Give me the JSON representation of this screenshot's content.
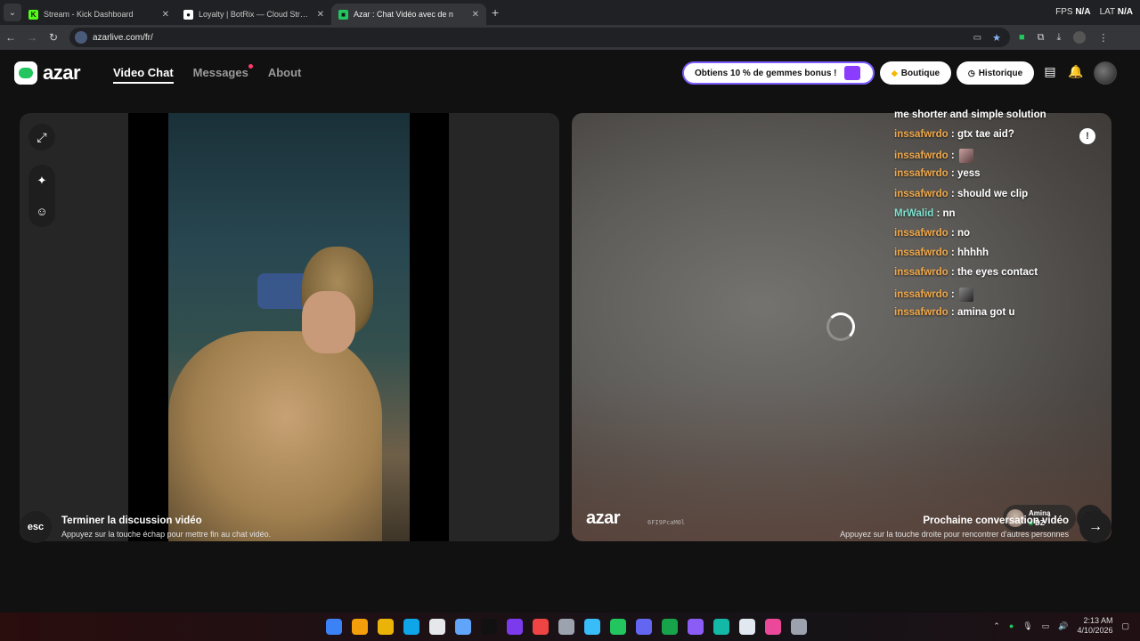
{
  "browser": {
    "tabs": [
      {
        "title": "Stream - Kick Dashboard",
        "favicon_color": "#53fc18",
        "favicon_glyph": "K",
        "active": false
      },
      {
        "title": "Loyalty | BotRix — Cloud Stream",
        "favicon_color": "#ffffff",
        "favicon_glyph": "●",
        "active": false
      },
      {
        "title": "Azar : Chat Vidéo avec de n",
        "favicon_color": "#22c55e",
        "favicon_glyph": "■",
        "active": true
      }
    ],
    "fps_label": "FPS",
    "fps_value": "N/A",
    "lat_label": "LAT",
    "lat_value": "N/A",
    "url": "azarlive.com/fr/"
  },
  "header": {
    "logo_text": "azar",
    "nav": [
      {
        "label": "Video Chat",
        "active": true
      },
      {
        "label": "Messages",
        "has_dot": true
      },
      {
        "label": "About"
      }
    ],
    "promo_label": "Obtiens 10 % de gemmes bonus !",
    "boutique_label": "Boutique",
    "historique_label": "Historique"
  },
  "remote": {
    "watermark": "azar",
    "match_id": "6FI9PcaM0l",
    "partner_name": "Amina",
    "partner_country": "DZ"
  },
  "chat": {
    "clipped_line": "me shorter and simple solution",
    "messages": [
      {
        "user": "inssafwrdo",
        "text": "gtx tae aid?"
      },
      {
        "user": "inssafwrdo",
        "text": "",
        "emote": true
      },
      {
        "user": "inssafwrdo",
        "text": "yess"
      },
      {
        "user": "inssafwrdo",
        "text": "should we clip"
      },
      {
        "user": "MrWalid",
        "text": "nn",
        "teal": true
      },
      {
        "user": "inssafwrdo",
        "text": "no"
      },
      {
        "user": "inssafwrdo",
        "text": "hhhhh"
      },
      {
        "user": "inssafwrdo",
        "text": "the eyes contact"
      },
      {
        "user": "inssafwrdo",
        "text": "",
        "emote": true,
        "dark": true
      },
      {
        "user": "inssafwrdo",
        "text": "amina got u"
      }
    ]
  },
  "footer": {
    "esc_label": "esc",
    "end_title": "Terminer la discussion vidéo",
    "end_sub": "Appuyez sur la touche échap pour mettre fin au chat vidéo.",
    "next_title": "Prochaine conversation vidéo",
    "next_sub": "Appuyez sur la touche droite pour rencontrer d'autres personnes"
  },
  "taskbar": {
    "time": "2:13 AM",
    "date": "4/10/2026",
    "icon_colors": [
      "#3b82f6",
      "#f59e0b",
      "#eab308",
      "#0ea5e9",
      "#e5e7eb",
      "#60a5fa",
      "#111111",
      "#7c3aed",
      "#ef4444",
      "#9ca3af",
      "#38bdf8",
      "#22c55e",
      "#6366f1",
      "#16a34a",
      "#8b5cf6",
      "#14b8a6",
      "#e2e8f0",
      "#ec4899",
      "#9ca3af"
    ]
  }
}
